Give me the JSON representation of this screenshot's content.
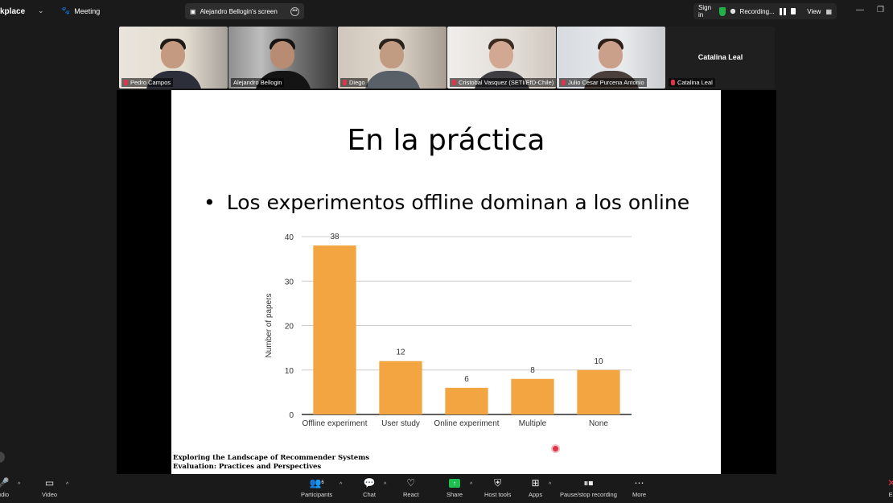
{
  "topbar": {
    "brand": "kplace",
    "meeting_label": "Meeting",
    "screen_tab": "Alejandro Bellogin's screen",
    "sign_in": "Sign in",
    "recording": "Recording...",
    "view": "View"
  },
  "participants": [
    {
      "name": "Pedro Campos",
      "muted": true
    },
    {
      "name": "Alejandro Bellogin",
      "muted": false
    },
    {
      "name": "Diego",
      "muted": true
    },
    {
      "name": "Cristobal Vasquez (SETI/EfD-Chile)",
      "muted": true
    },
    {
      "name": "Julio Cesar Purcena Antonio",
      "muted": true
    },
    {
      "name": "Catalina Leal",
      "muted": true,
      "camera_off": true
    }
  ],
  "slide": {
    "title": "En la práctica",
    "bullet": "Los experimentos offline dominan a los online",
    "footer_line1": "Exploring the Landscape of Recommender Systems",
    "footer_line2": "Evaluation: Practices and Perspectives"
  },
  "chart_data": {
    "type": "bar",
    "categories": [
      "Offline experiment",
      "User study",
      "Online experiment",
      "Multiple",
      "None"
    ],
    "values": [
      38,
      12,
      6,
      8,
      10
    ],
    "ylabel": "Number of papers",
    "xlabel": "",
    "ylim": [
      0,
      40
    ],
    "yticks": [
      0,
      10,
      20,
      30,
      40
    ],
    "bar_color": "#F2A541",
    "grid": true
  },
  "toolbar": {
    "audio": "udio",
    "video": "Video",
    "participants": "Participants",
    "participants_count": "6",
    "chat": "Chat",
    "react": "React",
    "share": "Share",
    "host_tools": "Host tools",
    "apps": "Apps",
    "pause_recording": "Pause/stop recording",
    "more": "More",
    "end": "Ei"
  }
}
